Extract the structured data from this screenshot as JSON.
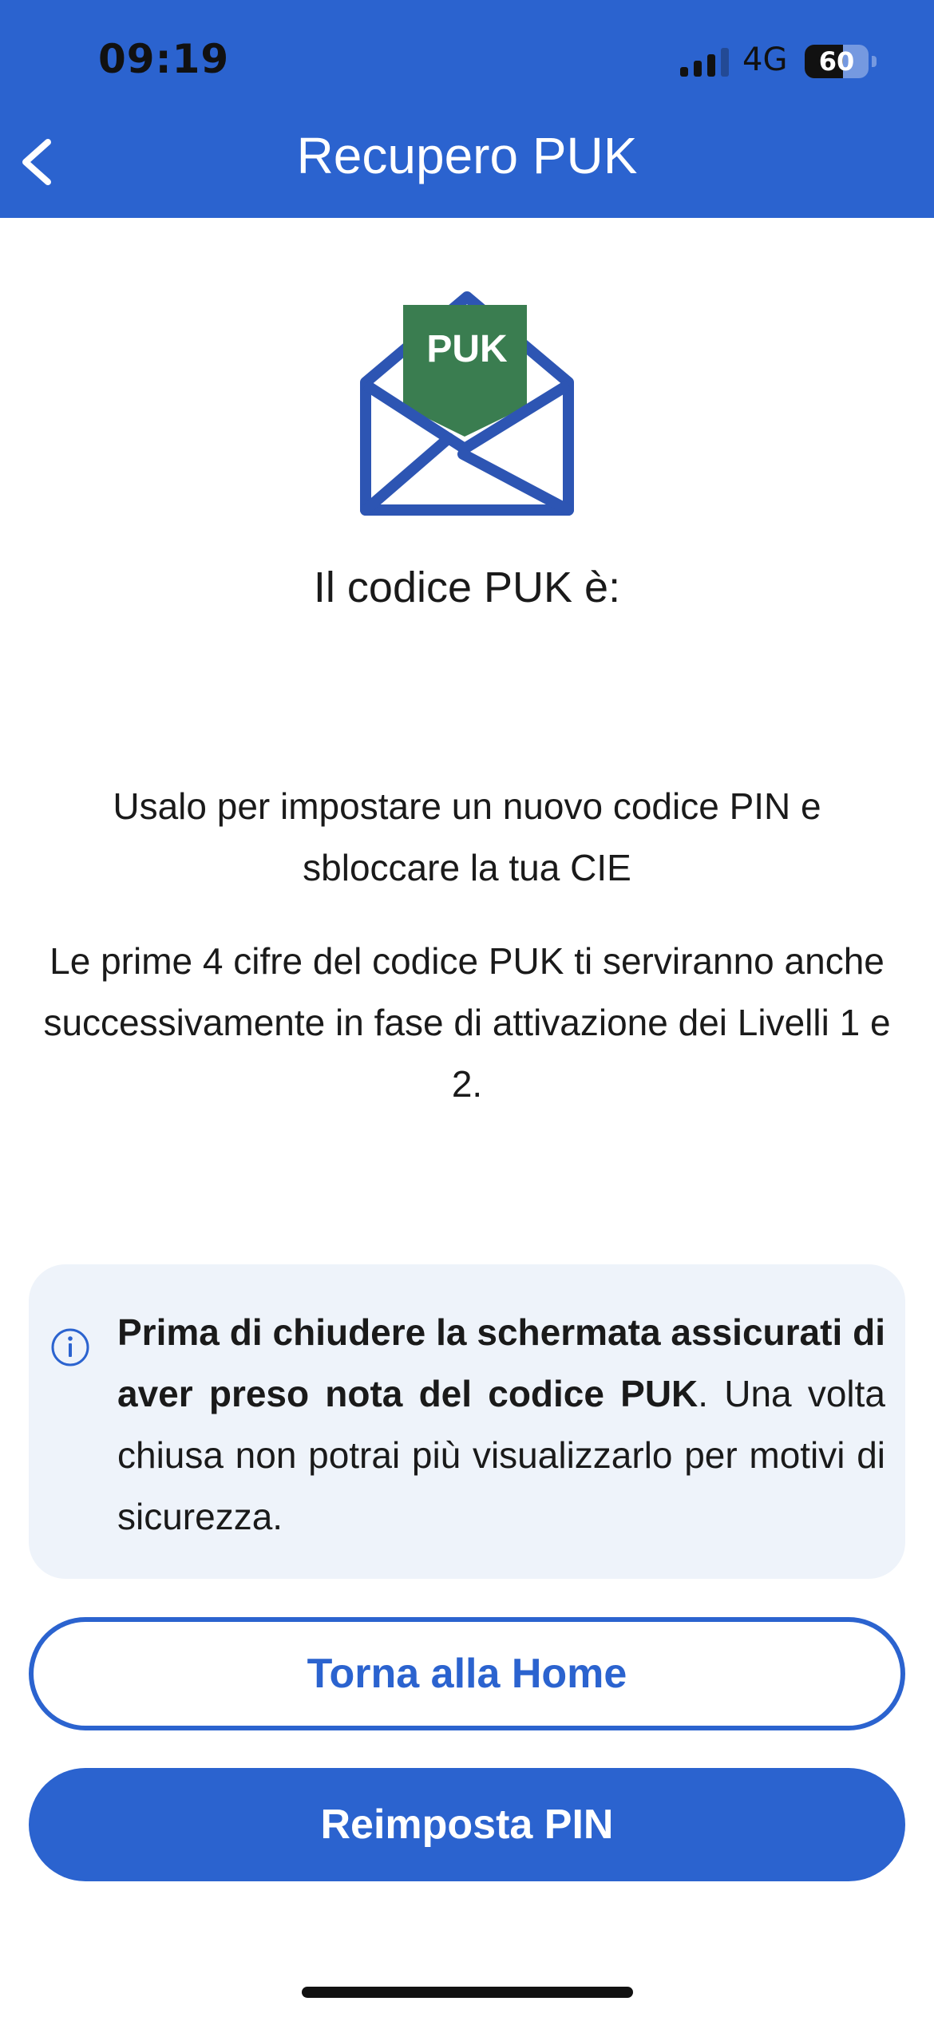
{
  "status_bar": {
    "time": "09:19",
    "network": "4G",
    "battery": "60",
    "battery_level": 0.6
  },
  "nav": {
    "title": "Recupero PUK",
    "back_icon": "chevron-left-icon"
  },
  "illustration": {
    "icon": "envelope-icon",
    "label": "PUK"
  },
  "content": {
    "heading": "Il codice PUK è:",
    "paragraph1": "Usalo per impostare un nuovo codice PIN e sbloccare la tua CIE",
    "paragraph2": "Le prime 4 cifre del codice PUK ti serviranno anche successivamente in fase di attivazione dei Livelli 1 e 2."
  },
  "notice": {
    "icon": "info-icon",
    "bold_text": "Prima di chiudere la schermata assicurati di aver preso nota del codice PUK",
    "text": ". Una volta chiusa non potrai più visualizzarlo per motivi di sicurezza."
  },
  "buttons": {
    "home": "Torna alla Home",
    "reset_pin": "Reimposta PIN"
  },
  "colors": {
    "primary": "#2B63CF",
    "puk_green": "#3A7D50",
    "notice_bg": "#EEF3FA"
  }
}
